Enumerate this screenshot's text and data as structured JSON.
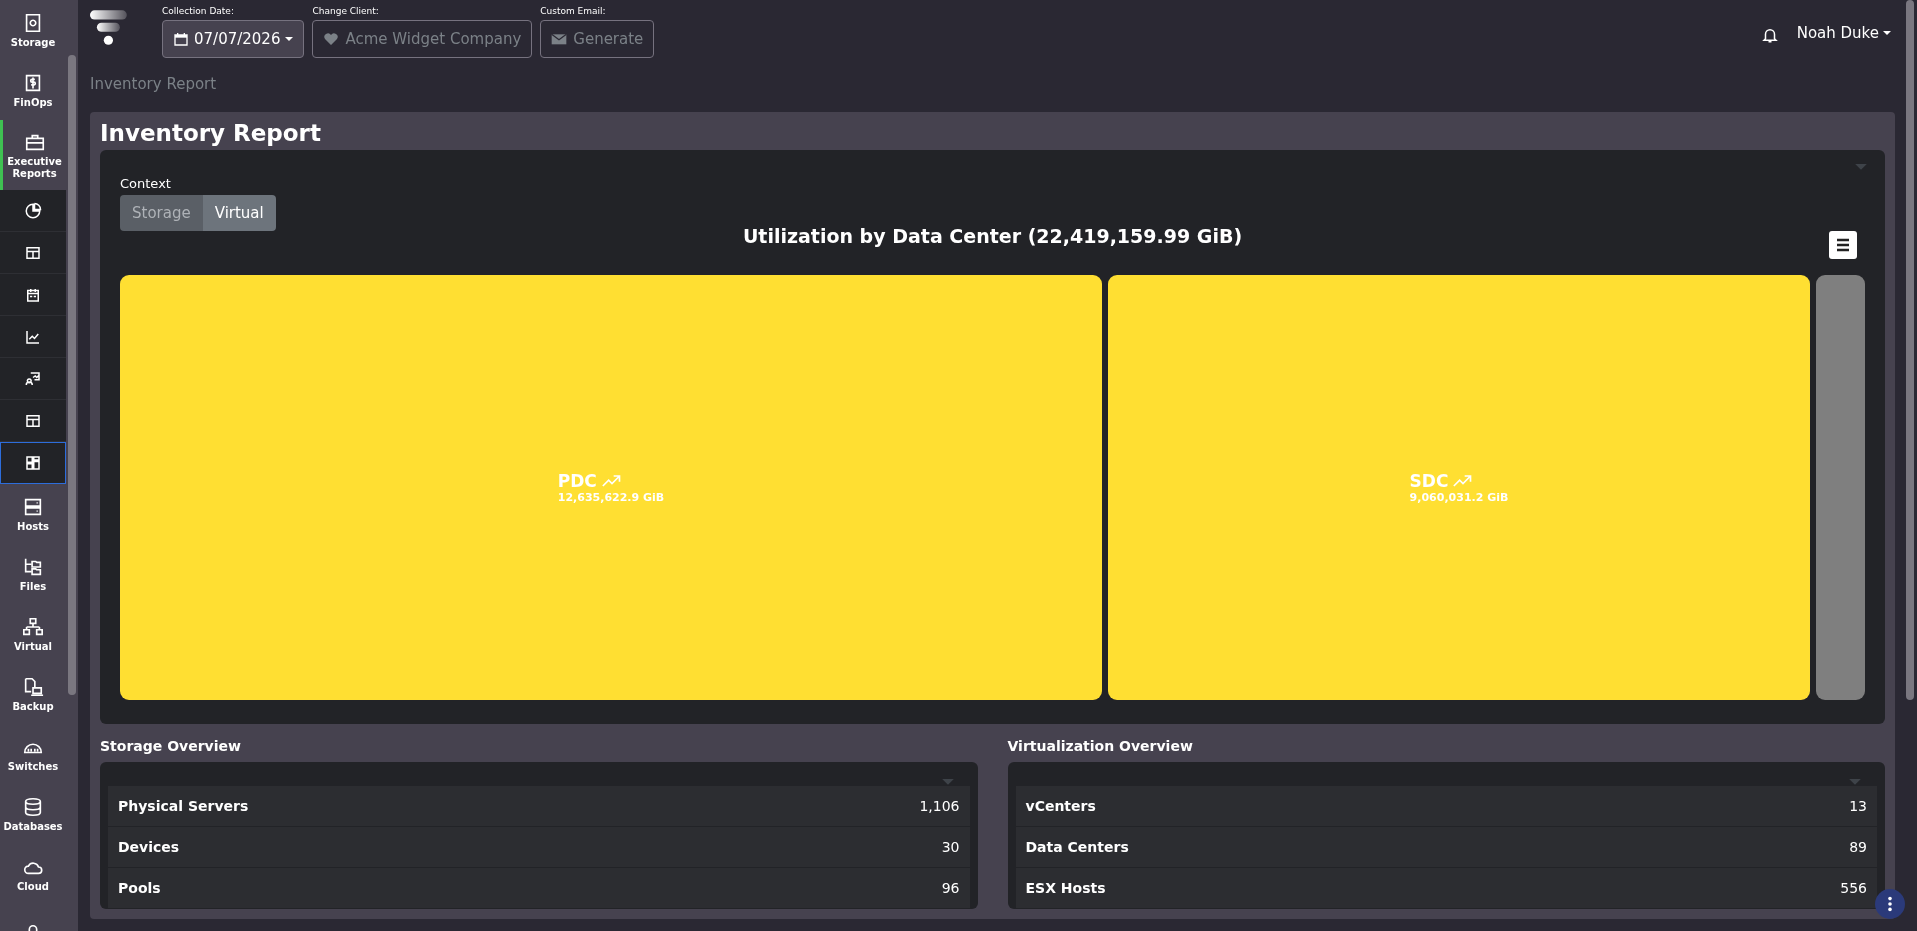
{
  "sidebar": {
    "items": [
      {
        "kind": "main",
        "label": "Storage",
        "selected": false
      },
      {
        "kind": "main",
        "label": "FinOps",
        "selected": false
      },
      {
        "kind": "main",
        "label": "Executive Reports",
        "selected": true
      },
      {
        "kind": "sub",
        "selected": false
      },
      {
        "kind": "sub",
        "selected": false
      },
      {
        "kind": "sub",
        "selected": false
      },
      {
        "kind": "sub",
        "selected": false
      },
      {
        "kind": "sub",
        "selected": false
      },
      {
        "kind": "sub",
        "selected": false
      },
      {
        "kind": "sub",
        "selected": true
      },
      {
        "kind": "main",
        "label": "Hosts",
        "selected": false
      },
      {
        "kind": "main",
        "label": "Files",
        "selected": false
      },
      {
        "kind": "main",
        "label": "Virtual",
        "selected": false
      },
      {
        "kind": "main",
        "label": "Backup",
        "selected": false
      },
      {
        "kind": "main",
        "label": "Switches",
        "selected": false
      },
      {
        "kind": "main",
        "label": "Databases",
        "selected": false
      },
      {
        "kind": "main",
        "label": "Cloud",
        "selected": false
      },
      {
        "kind": "main",
        "selected": false
      }
    ]
  },
  "header": {
    "collection_date": {
      "label": "Collection Date:",
      "value": "07/07/2026"
    },
    "change_client": {
      "label": "Change Client:",
      "value": "Acme Widget Company"
    },
    "custom_email": {
      "label": "Custom Email:",
      "button": "Generate"
    },
    "user": "Noah Duke"
  },
  "breadcrumb": "Inventory Report",
  "page_title": "Inventory Report",
  "context": {
    "label": "Context",
    "options": [
      {
        "label": "Storage",
        "selected": false
      },
      {
        "label": "Virtual",
        "selected": true
      }
    ]
  },
  "treemap": {
    "title": "Utilization by Data Center (22,419,159.99 GiB)",
    "tiles": [
      {
        "name": "PDC",
        "value": "12,635,622.9 GiB"
      },
      {
        "name": "SDC",
        "value": "9,060,031.2 GiB"
      }
    ]
  },
  "storage_overview": {
    "title": "Storage Overview",
    "rows": [
      {
        "label": "Physical Servers",
        "value": "1,106"
      },
      {
        "label": "Devices",
        "value": "30"
      },
      {
        "label": "Pools",
        "value": "96"
      }
    ]
  },
  "virtualization_overview": {
    "title": "Virtualization Overview",
    "rows": [
      {
        "label": "vCenters",
        "value": "13"
      },
      {
        "label": "Data Centers",
        "value": "89"
      },
      {
        "label": "ESX Hosts",
        "value": "556"
      }
    ]
  }
}
